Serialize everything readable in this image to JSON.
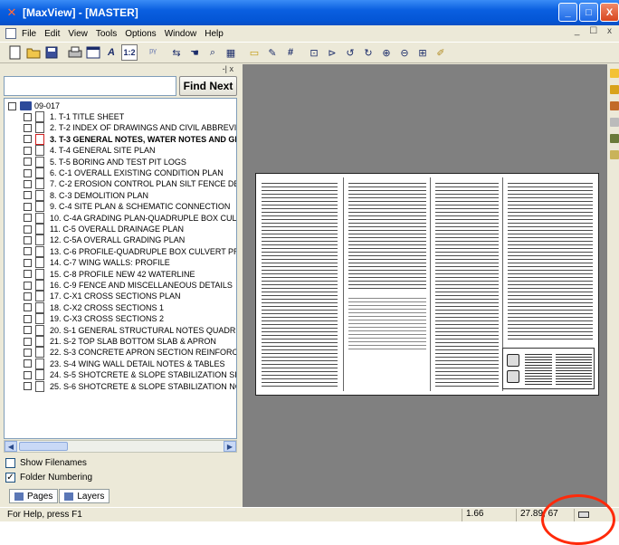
{
  "window": {
    "title": "[MaxView] - [MASTER]",
    "controls": {
      "minimize": "_",
      "maximize": "□",
      "close": "X"
    }
  },
  "menu": {
    "items": [
      "File",
      "Edit",
      "View",
      "Tools",
      "Options",
      "Window",
      "Help"
    ],
    "mdi_controls": "_ ☐ x"
  },
  "toolbar": {
    "tools": [
      "new-icon",
      "open-icon",
      "save-icon",
      "print-icon",
      "frame-icon",
      "text-icon",
      "one-two-icon",
      "annotate-icon",
      "pan-icon",
      "hand-icon",
      "zoom-area-icon",
      "grid-icon",
      "folder-icon",
      "pencil-icon",
      "hash-icon",
      "page-icon",
      "page-next-icon",
      "rotate-left-icon",
      "rotate-right-icon",
      "zoom-in-icon",
      "zoom-out-icon",
      "fit-icon",
      "pen-icon"
    ]
  },
  "left_panel": {
    "pin_close": "-| x",
    "search": {
      "value": "",
      "placeholder": ""
    },
    "find_next_label": "Find Next",
    "tree": {
      "root_label": "09-017",
      "items": [
        {
          "label": "1. T-1 TITLE SHEET",
          "bold": false
        },
        {
          "label": "2. T-2 INDEX OF DRAWINGS AND CIVIL ABBREVIAT",
          "bold": false
        },
        {
          "label": "3. T-3 GENERAL NOTES, WATER NOTES AND GE",
          "bold": true
        },
        {
          "label": "4. T-4 GENERAL SITE PLAN",
          "bold": false
        },
        {
          "label": "5. T-5 BORING AND TEST PIT LOGS",
          "bold": false
        },
        {
          "label": "6. C-1 OVERALL EXISTING CONDITION PLAN",
          "bold": false
        },
        {
          "label": "7. C-2 EROSION CONTROL PLAN SILT FENCE DETAI",
          "bold": false
        },
        {
          "label": "8. C-3 DEMOLITION PLAN",
          "bold": false
        },
        {
          "label": "9. C-4 SITE PLAN & SCHEMATIC CONNECTION",
          "bold": false
        },
        {
          "label": "10. C-4A GRADING PLAN-QUADRUPLE BOX CULVER",
          "bold": false
        },
        {
          "label": "11. C-5 OVERALL DRAINAGE PLAN",
          "bold": false
        },
        {
          "label": "12. C-5A OVERALL GRADING PLAN",
          "bold": false
        },
        {
          "label": "13. C-6 PROFILE-QUADRUPLE BOX CULVERT PROFI",
          "bold": false
        },
        {
          "label": "14. C-7 WING WALLS: PROFILE",
          "bold": false
        },
        {
          "label": "15. C-8 PROFILE NEW 42 WATERLINE",
          "bold": false
        },
        {
          "label": "16. C-9 FENCE AND MISCELLANEOUS DETAILS",
          "bold": false
        },
        {
          "label": "17. C-X1 CROSS SECTIONS PLAN",
          "bold": false
        },
        {
          "label": "18. C-X2 CROSS SECTIONS 1",
          "bold": false
        },
        {
          "label": "19. C-X3 CROSS SECTIONS 2",
          "bold": false
        },
        {
          "label": "20. S-1 GENERAL STRUCTURAL NOTES QUADRUPLE",
          "bold": false
        },
        {
          "label": "21. S-2 TOP SLAB BOTTOM SLAB & APRON",
          "bold": false
        },
        {
          "label": "22. S-3 CONCRETE APRON SECTION REINFORCEMI",
          "bold": false
        },
        {
          "label": "23. S-4 WING WALL DETAIL NOTES & TABLES",
          "bold": false
        },
        {
          "label": "24. S-5 SHOTCRETE & SLOPE STABILIZATION SITE",
          "bold": false
        },
        {
          "label": "25. S-6 SHOTCRETE & SLOPE STABILIZATION NOTE",
          "bold": false
        }
      ]
    },
    "show_filenames": {
      "label": "Show Filenames",
      "checked": false
    },
    "folder_numbering": {
      "label": "Folder Numbering",
      "checked": true
    },
    "tabs": [
      "Pages",
      "Layers"
    ]
  },
  "status": {
    "help_text": "For Help, press F1",
    "zoom": "1.66",
    "coords": "27.89, 67"
  }
}
